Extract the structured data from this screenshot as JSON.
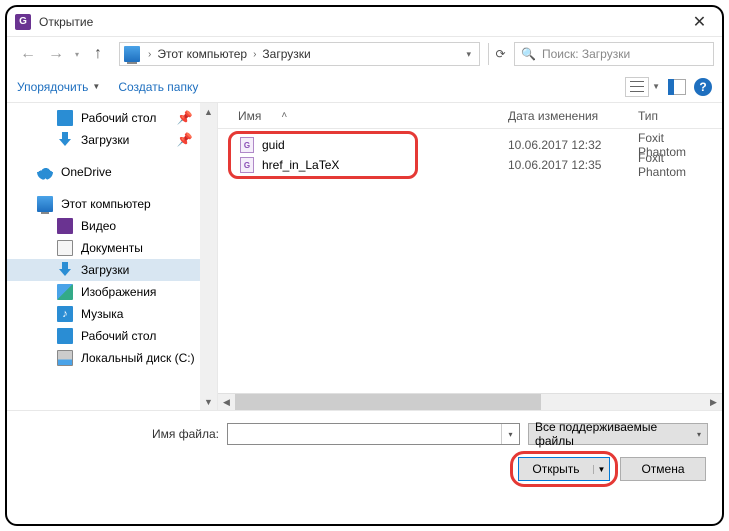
{
  "window": {
    "title": "Открытие",
    "app_badge": "G"
  },
  "breadcrumb": {
    "root": "Этот компьютер",
    "current": "Загрузки"
  },
  "search": {
    "placeholder": "Поиск: Загрузки"
  },
  "toolbar": {
    "organize": "Упорядочить",
    "new_folder": "Создать папку"
  },
  "columns": {
    "name": "Имя",
    "date": "Дата изменения",
    "type": "Тип"
  },
  "sidebar": {
    "quick": [
      {
        "label": "Рабочий стол",
        "icon": "desktop",
        "pin": true
      },
      {
        "label": "Загрузки",
        "icon": "download",
        "pin": true
      }
    ],
    "onedrive": {
      "label": "OneDrive"
    },
    "thispc": {
      "label": "Этот компьютер",
      "children": [
        {
          "label": "Видео",
          "icon": "video"
        },
        {
          "label": "Документы",
          "icon": "docs"
        },
        {
          "label": "Загрузки",
          "icon": "download",
          "selected": true
        },
        {
          "label": "Изображения",
          "icon": "images"
        },
        {
          "label": "Музыка",
          "icon": "music"
        },
        {
          "label": "Рабочий стол",
          "icon": "desktop"
        },
        {
          "label": "Локальный диск (C:)",
          "icon": "disk"
        }
      ]
    }
  },
  "files": [
    {
      "name": "guid",
      "date": "10.06.2017 12:32",
      "type": "Foxit Phantom"
    },
    {
      "name": "href_in_LaTeX",
      "date": "10.06.2017 12:35",
      "type": "Foxit Phantom"
    }
  ],
  "footer": {
    "filename_label": "Имя файла:",
    "filter": "Все поддерживаемые файлы",
    "open": "Открыть",
    "cancel": "Отмена"
  }
}
